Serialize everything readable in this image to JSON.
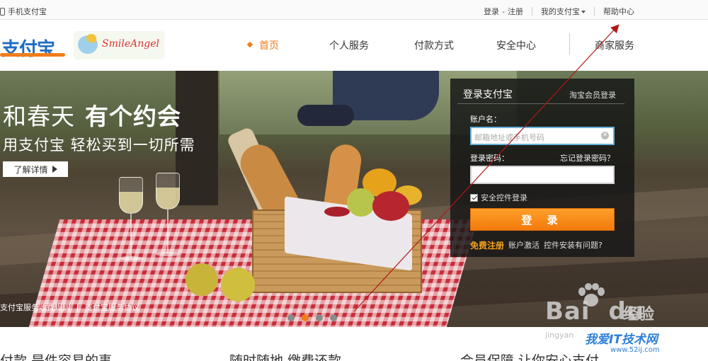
{
  "topbar": {
    "mobile": "手机支付宝",
    "login": "登录",
    "dash": "-",
    "register": "注册",
    "my_alipay": "我的支付宝",
    "help": "帮助中心"
  },
  "header": {
    "logo_text": "支付宝",
    "smile_text": "SmileAngel",
    "nav": [
      "首页",
      "个人服务",
      "付款方式",
      "安全中心",
      "商家服务"
    ]
  },
  "hero": {
    "title_a": "和春天",
    "title_b": "有个约会",
    "subtitle": "用支付宝  轻松买到一切所需",
    "button": "了解详情",
    "links": [
      "支付宝服务收费规则",
      "支付宝服务协议"
    ]
  },
  "login": {
    "title": "登录支付宝",
    "alt_login": "淘宝会员登录",
    "user_label": "账户名：",
    "user_placeholder": "邮箱地址或手机号码",
    "pwd_label": "登录密码：",
    "forgot": "忘记登录密码？",
    "secure": "安全控件登录",
    "button": "登 录",
    "register": "免费注册",
    "activate": "账户激活",
    "help": "控件安装有问题?"
  },
  "watermark": {
    "baidu": "Bai",
    "du": "du",
    "jingyan": "经验",
    "jingyan_url": "jingyan",
    "site": "我爱IT技术网",
    "site_url": "www.52ij.com"
  },
  "bottom": {
    "col1": "付款 是件容易的事",
    "col2": "随时随地 缴费还款",
    "col3": "会员保障 让你安心支付"
  },
  "colors": {
    "accent": "#f07d1a",
    "brand_blue": "#1e6cc1",
    "arrow": "#b01818"
  }
}
